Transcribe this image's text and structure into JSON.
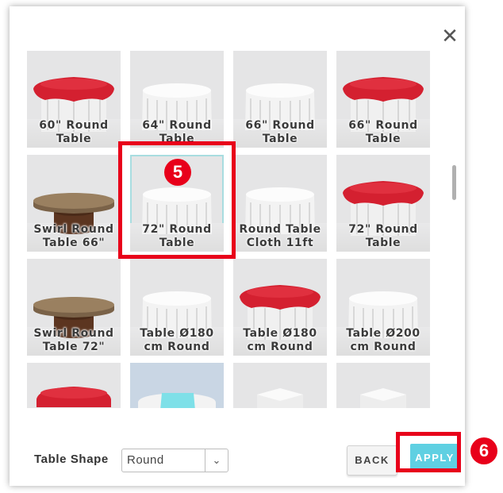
{
  "dialog": {
    "close_icon": "close-icon"
  },
  "tables": [
    {
      "label": "60\" Round Table",
      "style": "red-cloth"
    },
    {
      "label": "64\" Round Table",
      "style": "white-cloth"
    },
    {
      "label": "66\" Round Table",
      "style": "white-cloth"
    },
    {
      "label": "66\" Round Table",
      "style": "red-cloth"
    },
    {
      "label": "Swirl Round Table 66\"",
      "style": "wood-round"
    },
    {
      "label": "72\" Round Table",
      "style": "white-cloth",
      "selected": true
    },
    {
      "label": "Round Table Cloth 11ft",
      "style": "white-cloth"
    },
    {
      "label": "72\" Round Table",
      "style": "red-cloth"
    },
    {
      "label": "Swirl Round Table 72\"",
      "style": "wood-round"
    },
    {
      "label": "Table Ø180 cm Round",
      "style": "white-cloth"
    },
    {
      "label": "Table Ø180 cm Round",
      "style": "red-cloth"
    },
    {
      "label": "Table Ø200 cm Round",
      "style": "white-cloth"
    },
    {
      "label": "",
      "style": "red-cloth-partial"
    },
    {
      "label": "",
      "style": "blue-partial"
    },
    {
      "label": "",
      "style": "cube-partial"
    },
    {
      "label": "",
      "style": "cube-partial"
    }
  ],
  "footer": {
    "table_shape_label": "Table Shape",
    "shape_select": {
      "value": "Round"
    },
    "back_label": "BACK",
    "apply_label": "APPLY"
  },
  "annotations": {
    "step5": "5",
    "step6": "6"
  },
  "colors": {
    "accent": "#5fd0e2",
    "highlight": "#e8001a",
    "cloth_red": "#d42030"
  }
}
